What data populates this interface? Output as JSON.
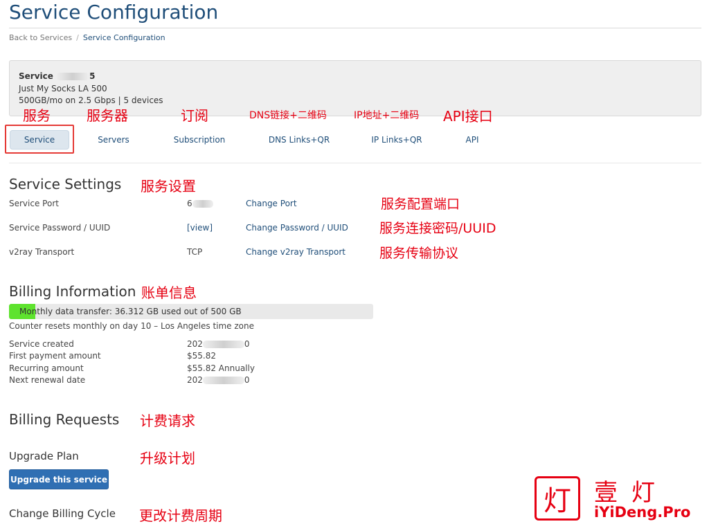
{
  "page": {
    "title": "Service Configuration"
  },
  "breadcrumb": {
    "back": "Back to Services",
    "separator": "/",
    "current": "Service Configuration"
  },
  "service": {
    "label": "Service",
    "name_suffix": "5",
    "plan": "Just My Socks LA 500",
    "details": "500GB/mo on 2.5 Gbps | 5 devices"
  },
  "tabs": [
    {
      "label": "Service",
      "annotation": "服务",
      "active": true
    },
    {
      "label": "Servers",
      "annotation": "服务器"
    },
    {
      "label": "Subscription",
      "annotation": "订阅"
    },
    {
      "label": "DNS Links+QR",
      "annotation": "DNS链接+二维码"
    },
    {
      "label": "IP Links+QR",
      "annotation": "IP地址+二维码"
    },
    {
      "label": "API",
      "annotation": "API接口"
    }
  ],
  "settings": {
    "title": "Service Settings",
    "annotation": "服务设置",
    "rows": [
      {
        "label": "Service Port",
        "value": "6",
        "action": "Change Port",
        "annotation": "服务配置端口"
      },
      {
        "label": "Service Password / UUID",
        "value": "[view]",
        "action": "Change Password / UUID",
        "annotation": "服务连接密码/UUID"
      },
      {
        "label": "v2ray Transport",
        "value": "TCP",
        "action": "Change v2ray Transport",
        "annotation": "服务传输协议"
      }
    ]
  },
  "billing": {
    "title": "Billing Information",
    "annotation": "账单信息",
    "transfer_label": "Monthly data transfer: 36.312 GB used out of 500 GB",
    "transfer_used_fraction": 0.0726,
    "reset_note": "Counter resets monthly on day 10 – Los Angeles time zone",
    "rows": [
      {
        "label": "Service created",
        "value_prefix": "202",
        "value_suffix": "0"
      },
      {
        "label": "First payment amount",
        "value": "$55.82"
      },
      {
        "label": "Recurring amount",
        "value": "$55.82 Annually"
      },
      {
        "label": "Next renewal date",
        "value_prefix": "202",
        "value_suffix": "0"
      }
    ]
  },
  "requests": {
    "title": "Billing Requests",
    "annotation": "计费请求",
    "upgrade_title": "Upgrade Plan",
    "upgrade_annotation": "升级计划",
    "upgrade_button": "Upgrade this service",
    "cycle_title": "Change Billing Cycle",
    "cycle_annotation": "更改计费周期"
  },
  "watermark": {
    "icon_char": "灯",
    "chinese": "壹灯",
    "english": "iYiDeng.Pro"
  },
  "colors": {
    "accent": "#1f4e79",
    "button": "#2f6fb3",
    "progress": "#5ee32e",
    "annotation": "#e60012"
  }
}
